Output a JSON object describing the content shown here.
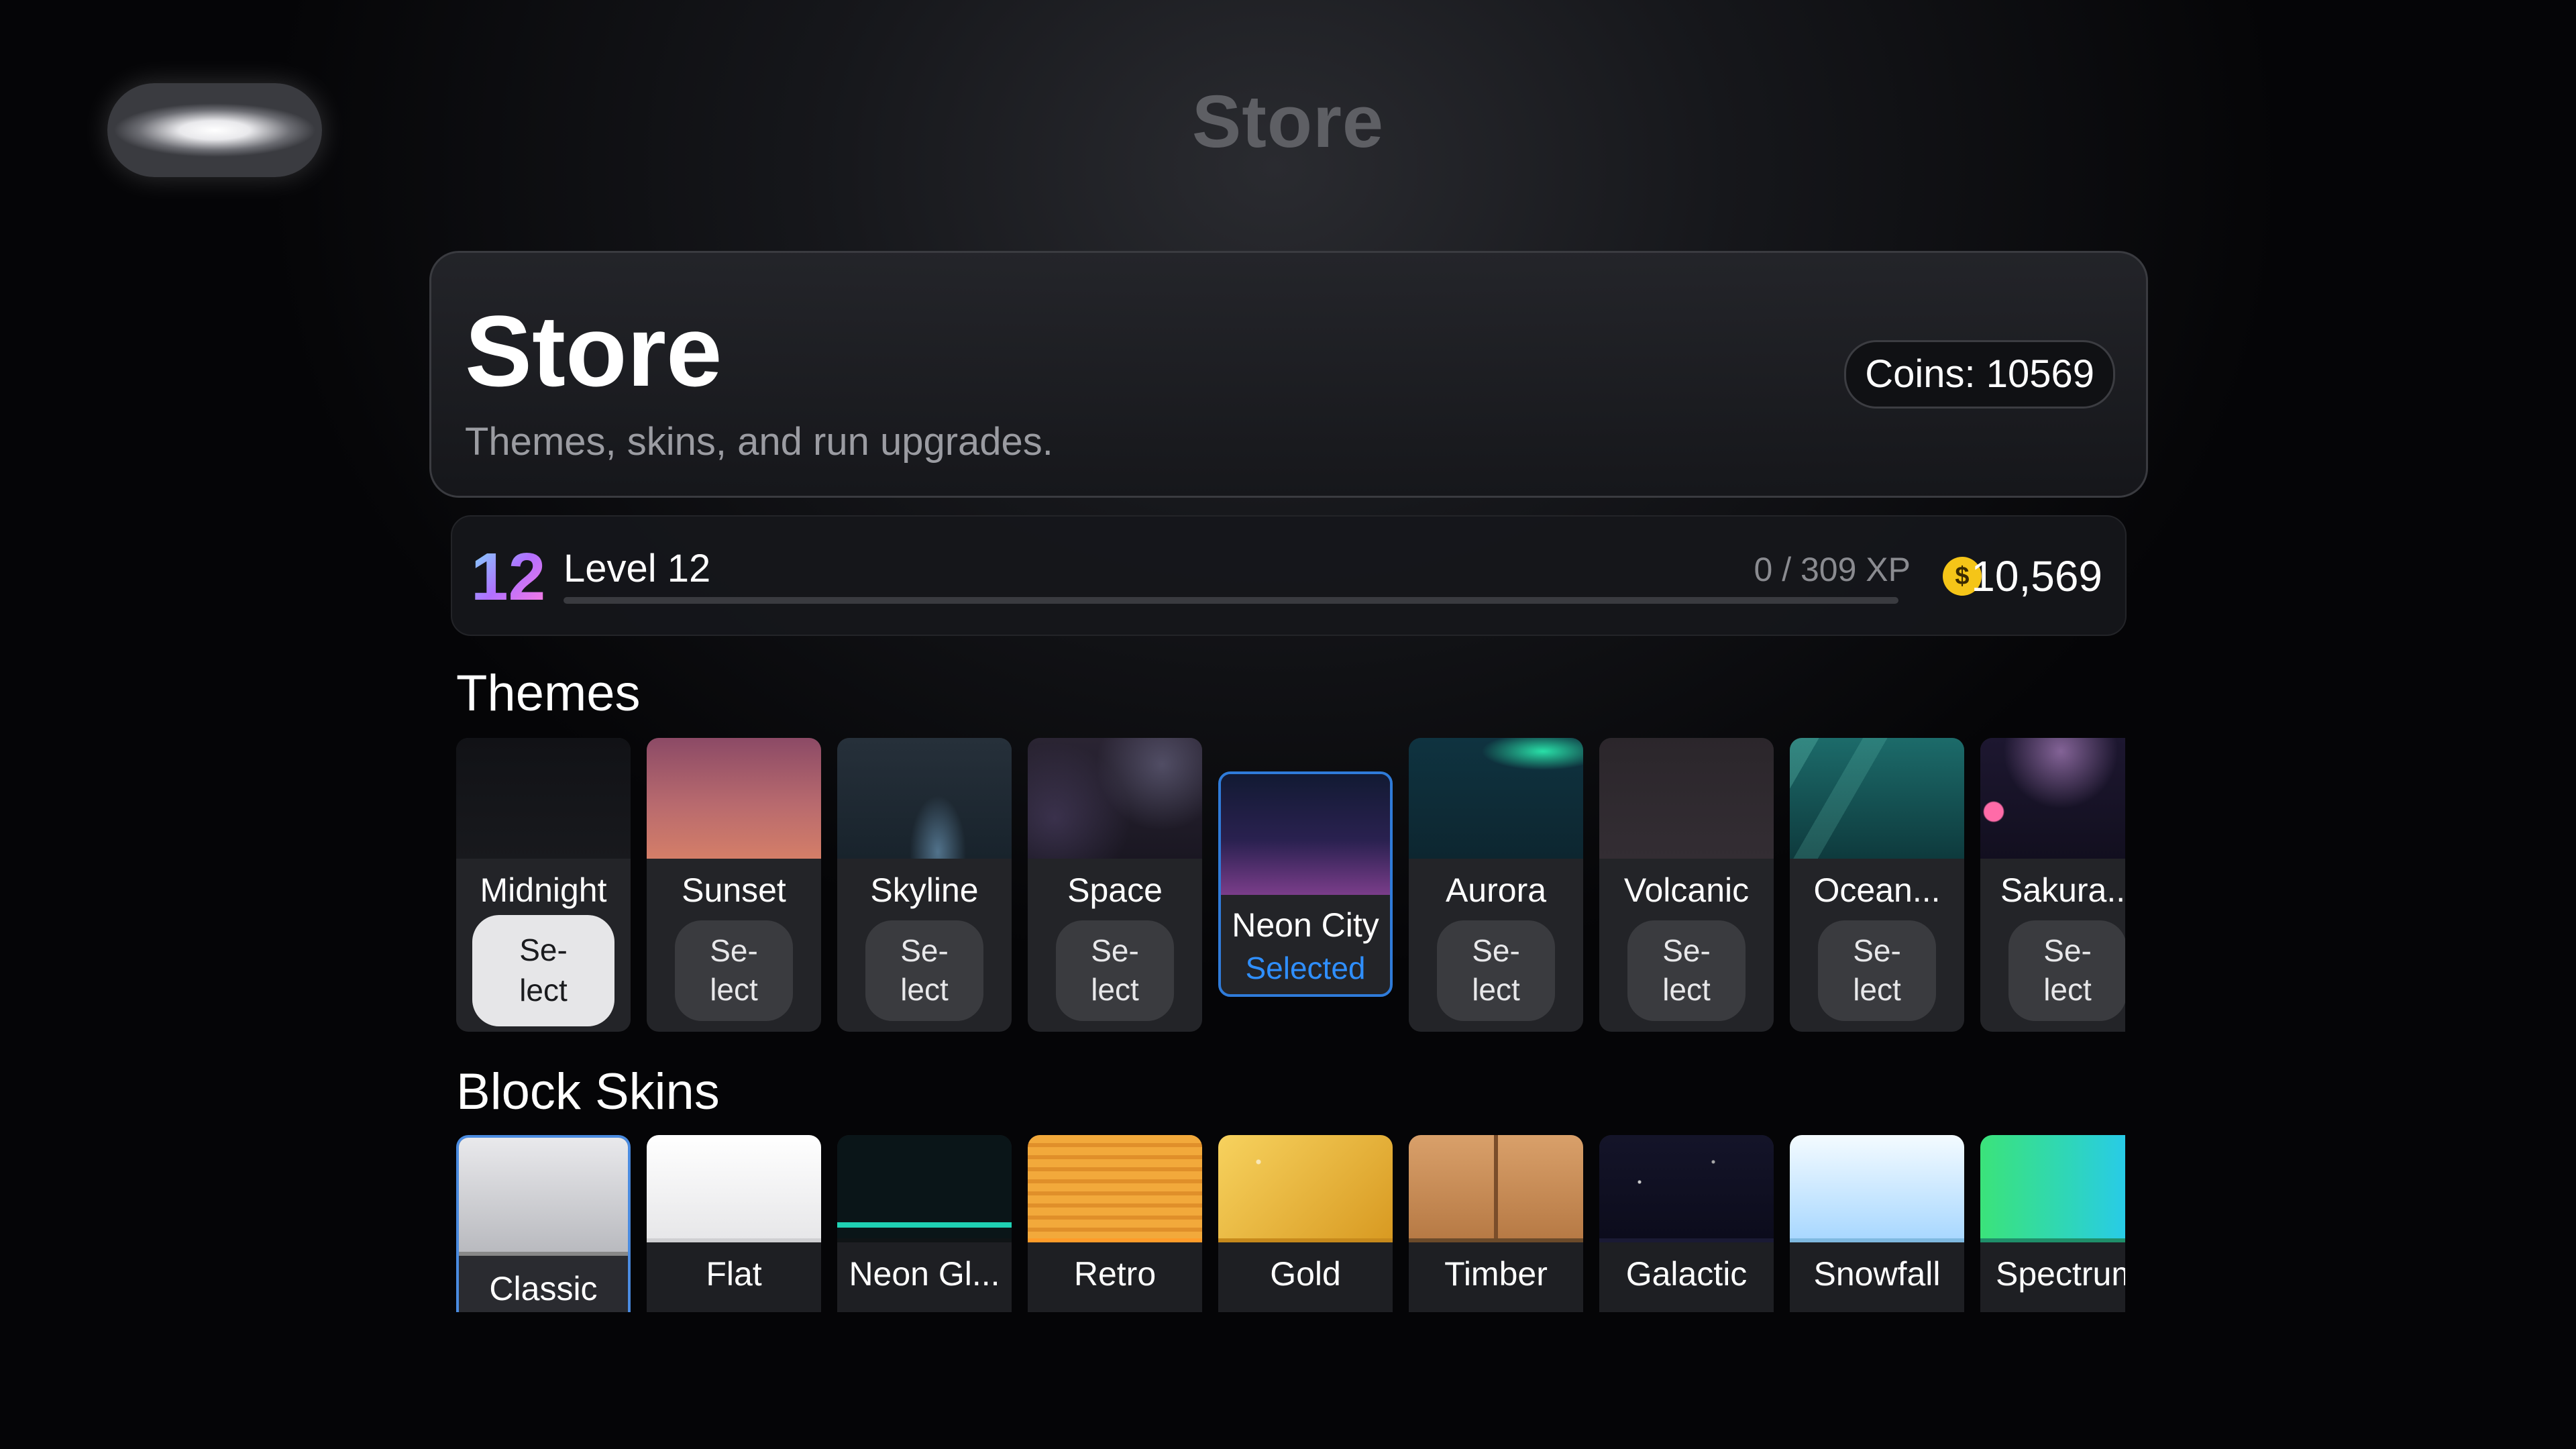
{
  "nav": {
    "title": "Store"
  },
  "header": {
    "title": "Store",
    "subtitle": "Themes, skins, and run upgrades.",
    "coins_label": "Coins: 10569"
  },
  "level": {
    "badge": "12",
    "label": "Level 12",
    "xp_text": "0 / 309 XP",
    "xp_progress": 0,
    "coin_symbol": "$",
    "coins": "10,569"
  },
  "sections": {
    "themes": "Themes",
    "skins": "Block Skins"
  },
  "themes": [
    {
      "name": "Midnight",
      "action": "Se-\nlect",
      "state": "focused"
    },
    {
      "name": "Sunset",
      "action": "Se-\nlect",
      "state": "normal"
    },
    {
      "name": "Skyline",
      "action": "Se-\nlect",
      "state": "normal"
    },
    {
      "name": "Space",
      "action": "Se-\nlect",
      "state": "normal"
    },
    {
      "name": "Neon City",
      "action": "Selected",
      "state": "selected"
    },
    {
      "name": "Aurora",
      "action": "Se-\nlect",
      "state": "normal"
    },
    {
      "name": "Volcanic",
      "action": "Se-\nlect",
      "state": "normal"
    },
    {
      "name": "Ocean...",
      "action": "Se-\nlect",
      "state": "normal"
    },
    {
      "name": "Sakura...",
      "action": "Se-\nlect",
      "state": "normal"
    }
  ],
  "skins": [
    {
      "name": "Classic",
      "state": "selected"
    },
    {
      "name": "Flat",
      "state": "normal"
    },
    {
      "name": "Neon Gl...",
      "state": "normal"
    },
    {
      "name": "Retro",
      "state": "normal"
    },
    {
      "name": "Gold",
      "state": "normal"
    },
    {
      "name": "Timber",
      "state": "normal"
    },
    {
      "name": "Galactic",
      "state": "normal"
    },
    {
      "name": "Snowfall",
      "state": "normal"
    },
    {
      "name": "Spectrum",
      "state": "normal"
    }
  ],
  "colors": {
    "accent": "#2f8fff",
    "coin": "#f5c518"
  }
}
